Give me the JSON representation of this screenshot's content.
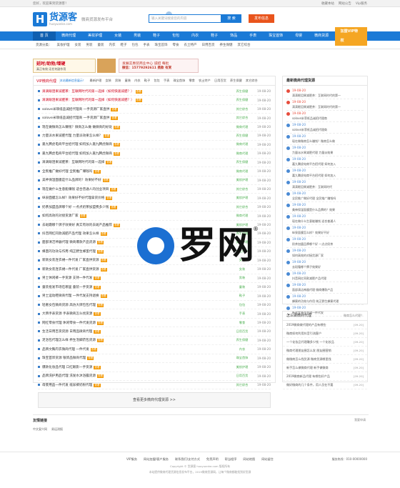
{
  "topbar": {
    "left": "您好，欢迎来到货源客！",
    "links": [
      "收藏本站",
      "网站公告",
      "Vip服务"
    ]
  },
  "header": {
    "logo_letter": "H",
    "site_name": "货源客",
    "domain": "huoyuanke.com",
    "slogan": "微商货源发布平台",
    "search_placeholder": "输入关键词搜索您的内容",
    "search_button": "搜 索",
    "publish_button": "发布信息"
  },
  "nav": {
    "items": [
      "首 页",
      "微商代理",
      "美妆护理",
      "女装",
      "男装",
      "鞋子",
      "包包",
      "内衣",
      "鞋子",
      "饰品",
      "手表",
      "珠宝首饰",
      "母婴",
      "微商货源"
    ],
    "vip": "加盟VIP特权"
  },
  "subnav": {
    "label": "货源分类：",
    "items": [
      "美妆护理",
      "女装",
      "男装",
      "童装",
      "内衣",
      "鞋子",
      "包包",
      "手表",
      "珠宝首饰",
      "零食",
      "农土特产",
      "日用百货",
      "养生保健",
      "其它综合"
    ]
  },
  "banner": {
    "left_title": "延时/助勃/增硬",
    "left_sub": "真正有效·无任何副作用",
    "right_title": "发展实惠装商业中心 诚招 每批",
    "right_sub": "微信：15779292611 携款 有赏"
  },
  "main": {
    "tab_active": "VIP微商代理",
    "tab_hint": "本站最新信息展示！",
    "tabs": [
      "最新护理",
      "女装",
      "男装",
      "童装",
      "内衣",
      "鞋子",
      "包包",
      "手表",
      "珠宝首饰",
      "零食",
      "农土特产",
      "日用百货",
      "养生保健",
      "其它综合"
    ],
    "rows": [
      {
        "title": "滴滴眼泪果减肥茶：互联网时代的第一选择（如何快速减肥？）",
        "cat": "养生保健",
        "date": "19-08-20",
        "red": true
      },
      {
        "title": "滴滴眼泪果减肥茶：互联网时代的第一选择（如何快速减肥？）",
        "cat": "养生保健",
        "date": "19-08-20",
        "red": true
      },
      {
        "title": "solove米菲纸品诚招代理商 一手货源厂家直供",
        "cat": "其它综合",
        "date": "19-08-20",
        "red": false
      },
      {
        "title": "solove米菲纸品诚招代理商 一手货源厂家直供",
        "cat": "其它综合",
        "date": "19-08-20",
        "red": false
      },
      {
        "title": "现在做微商怎么赚钱？微商怎么做 做微商的好处",
        "cat": "微商代理",
        "date": "19-08-20",
        "red": false
      },
      {
        "title": "力量派水果减肥代理 力量派效果怎么样？",
        "cat": "养生保健",
        "date": "19-08-20",
        "red": false
      },
      {
        "title": "嘉九腾虎电商平台招代理 如何加入嘉九腾虎微商",
        "cat": "微商代理",
        "date": "19-08-20",
        "red": false
      },
      {
        "title": "嘉九腾虎电商平台招代理 如何加入嘉九腾虎微商",
        "cat": "微商代理",
        "date": "19-08-20",
        "red": false
      },
      {
        "title": "滴滴眼泪果减肥茶：互联网时代的第一选择",
        "cat": "养生保健",
        "date": "19-08-20",
        "red": false
      },
      {
        "title": "全民推广做好代理 全民推广赚钱吗",
        "cat": "微商代理",
        "date": "19-08-20",
        "red": false
      },
      {
        "title": "美神保湿面膜是什么品牌的？效果好不好",
        "cat": "美妆护理",
        "date": "19-08-20",
        "red": false
      },
      {
        "title": "现在做什么生意能赚钱 适合普通人的创业项目",
        "cat": "其它综合",
        "date": "19-08-20",
        "red": false
      },
      {
        "title": "纵泉面膜怎么样？效果好不好代理拿货价格",
        "cat": "美妆护理",
        "date": "19-08-20",
        "red": false
      },
      {
        "title": "奶茶加盟品牌哪个好 一点点奶茶加盟费多少钱",
        "cat": "其它综合",
        "date": "19-08-20",
        "red": false
      },
      {
        "title": "如何高效的对接货源厂家",
        "cat": "微商代理",
        "date": "19-08-20",
        "red": false
      },
      {
        "title": "去斑霜哪个牌子效果好 真实有效的去斑产品推荐",
        "cat": "美妆护理",
        "date": "19-08-20",
        "red": false
      },
      {
        "title": "抖音网红同款减肥产品代理 效果怎么样",
        "cat": "养生保健",
        "date": "19-08-20",
        "red": false
      },
      {
        "title": "面部清洁神器代理 微商爆款产品货源",
        "cat": "美妆护理",
        "date": "19-08-20",
        "red": false
      },
      {
        "title": "蜂蜜的功效与作用 纯正野生蜂蜜代理",
        "cat": "农土特产",
        "date": "19-08-20",
        "red": false
      },
      {
        "title": "新款女装连衣裙一件代发 厂家直供货源",
        "cat": "女装",
        "date": "19-08-20",
        "red": false
      },
      {
        "title": "新款女装连衣裙一件代发 厂家直供货源",
        "cat": "女装",
        "date": "19-08-20",
        "red": false
      },
      {
        "title": "男士休闲裤一手货源 支持一件代发",
        "cat": "男装",
        "date": "19-08-20",
        "red": false
      },
      {
        "title": "童装批发市场在哪里 童装一手货源",
        "cat": "童装",
        "date": "19-08-20",
        "red": false
      },
      {
        "title": "男士运动鞋微商代理 一件代发支持退换",
        "cat": "鞋子",
        "date": "19-08-20",
        "red": false
      },
      {
        "title": "轻奢女包微商货源 高仿大牌包包代理",
        "cat": "包包",
        "date": "19-08-20",
        "red": false
      },
      {
        "title": "大牌手表货源 手表微商怎么找货源",
        "cat": "手表",
        "date": "19-08-20",
        "red": false
      },
      {
        "title": "网红零食代理 休闲零食一件代发货源",
        "cat": "零食",
        "date": "19-08-20",
        "red": false
      },
      {
        "title": "生活日用百货货源 日用品微商代理",
        "cat": "日用百货",
        "date": "19-08-20",
        "red": false
      },
      {
        "title": "足浴包代理怎么样 养生泡脚药包货源",
        "cat": "养生保健",
        "date": "19-08-20",
        "red": false
      },
      {
        "title": "品牌文胸内衣微商代理 一件代发",
        "cat": "内衣",
        "date": "19-08-20",
        "red": false
      },
      {
        "title": "珠宝首饰货源 银饰品微商代理",
        "cat": "珠宝首饰",
        "date": "19-08-20",
        "red": false
      },
      {
        "title": "爆款化妆品代理 口红眼影一手货源",
        "cat": "美妆护理",
        "date": "19-08-20",
        "red": false
      },
      {
        "title": "品牌洗护用品代理 洗发水沐浴露货源",
        "cat": "日用百货",
        "date": "19-08-20",
        "red": false
      },
      {
        "title": "母婴用品一件代发 纸尿裤奶粉代理",
        "cat": "其它综合",
        "date": "19-08-20",
        "red": false
      }
    ],
    "tag_label": "查看",
    "more": "查看更多微商代理货源 >>"
  },
  "side": {
    "title": "最新微商代理货源",
    "items": [
      {
        "date": "19-08-20",
        "title": "滴滴眼泪果减肥茶：互联网时代的第一",
        "hot": true
      },
      {
        "date": "19-08-20",
        "title": "滴滴眼泪果减肥茶：互联网时代的第一",
        "hot": true
      },
      {
        "date": "19-08-20",
        "title": "solove米菲纸品诚招代理商",
        "hot": true
      },
      {
        "date": "19-08-20",
        "title": "solove米菲纸品诚招代理商",
        "hot": false
      },
      {
        "date": "19-08-20",
        "title": "现在做微商怎么赚钱？微商怎么做",
        "hot": false
      },
      {
        "date": "19-08-20",
        "title": "力量派水果减肥代理 力量派效果",
        "hot": false
      },
      {
        "date": "19-08-20",
        "title": "嘉九腾虎电商平台招代理 如何加入",
        "hot": false
      },
      {
        "date": "19-08-20",
        "title": "嘉九腾虎电商平台招代理 如何加入",
        "hot": false
      },
      {
        "date": "19-08-20",
        "title": "滴滴眼泪果减肥茶：互联网时代",
        "hot": false
      },
      {
        "date": "19-08-20",
        "title": "全民推广做好代理 全民推广赚钱吗",
        "hot": false
      },
      {
        "date": "19-08-20",
        "title": "美神保湿面膜是什么品牌的？效果",
        "hot": false
      },
      {
        "date": "19-08-20",
        "title": "现在做什么生意能赚钱 适合普通人",
        "hot": false
      },
      {
        "date": "19-08-20",
        "title": "纵泉面膜怎么样？效果好不好",
        "hot": false
      },
      {
        "date": "19-08-20",
        "title": "奶茶加盟品牌哪个好 一点点奶茶",
        "hot": false
      },
      {
        "date": "19-08-20",
        "title": "如何高效的对接货源厂家",
        "hot": false
      },
      {
        "date": "19-08-20",
        "title": "去斑霜哪个牌子效果好",
        "hot": false
      },
      {
        "date": "19-08-20",
        "title": "抖音网红同款减肥产品代理",
        "hot": false
      },
      {
        "date": "19-08-20",
        "title": "面部清洁神器代理 微商爆款产品",
        "hot": false
      },
      {
        "date": "19-08-20",
        "title": "蜂蜜的功效与作用 纯正野生蜂蜜代理",
        "hot": false
      },
      {
        "date": "19-08-20",
        "title": "新款女装连衣裙一件代发",
        "hot": false
      }
    ]
  },
  "side2": {
    "title": "怎么做微商代理",
    "more": "微商怎么代理？",
    "items": [
      {
        "title": "2019微商做代理的产品有哪些",
        "date": "[09-20]"
      },
      {
        "title": "微商如何利用抖音引流客户",
        "date": "[09-20]"
      },
      {
        "title": "一个化妆品代理赚多少钱 一个化妆品",
        "date": "[09-20]"
      },
      {
        "title": "微商代理朋友圈怎么发 朋友圈营销",
        "date": "[09-20]"
      },
      {
        "title": "做微商怎么找货源 微商货源哪里找",
        "date": "[09-20]"
      },
      {
        "title": "新手怎么做微商代理 新手做微商",
        "date": "[09-20]"
      },
      {
        "title": "2019微商新品代理 有哪些好产品",
        "date": "[09-20]"
      },
      {
        "title": "做好微商的几个条件，用人员在不要",
        "date": "[09-20]"
      }
    ]
  },
  "friend": {
    "title": "友情链接",
    "apply": "我要申请",
    "links": [
      "中文复兴网",
      "易运测报"
    ]
  },
  "footer": {
    "links": [
      "VIP服务",
      "网站加盟/客户服务",
      "联系我们/支付方式",
      "免责声明",
      "帮当程序",
      "网站地图",
      "网站留言"
    ],
    "tel": "服务热线：010-00000000",
    "copyright": "Copyright © 货源客 huoyuanke.com 版权所有",
    "desc": "本站提供微商代理货源信息发布平台，2019微商货源网，让每个微商都能找到好货源"
  },
  "watermark": {
    "text": "罗网",
    "reg": "®"
  },
  "colors": {
    "primary": "#1b7ad6",
    "accent": "#e9541c",
    "vip": "#f5a623",
    "hot": "#d0021b"
  }
}
